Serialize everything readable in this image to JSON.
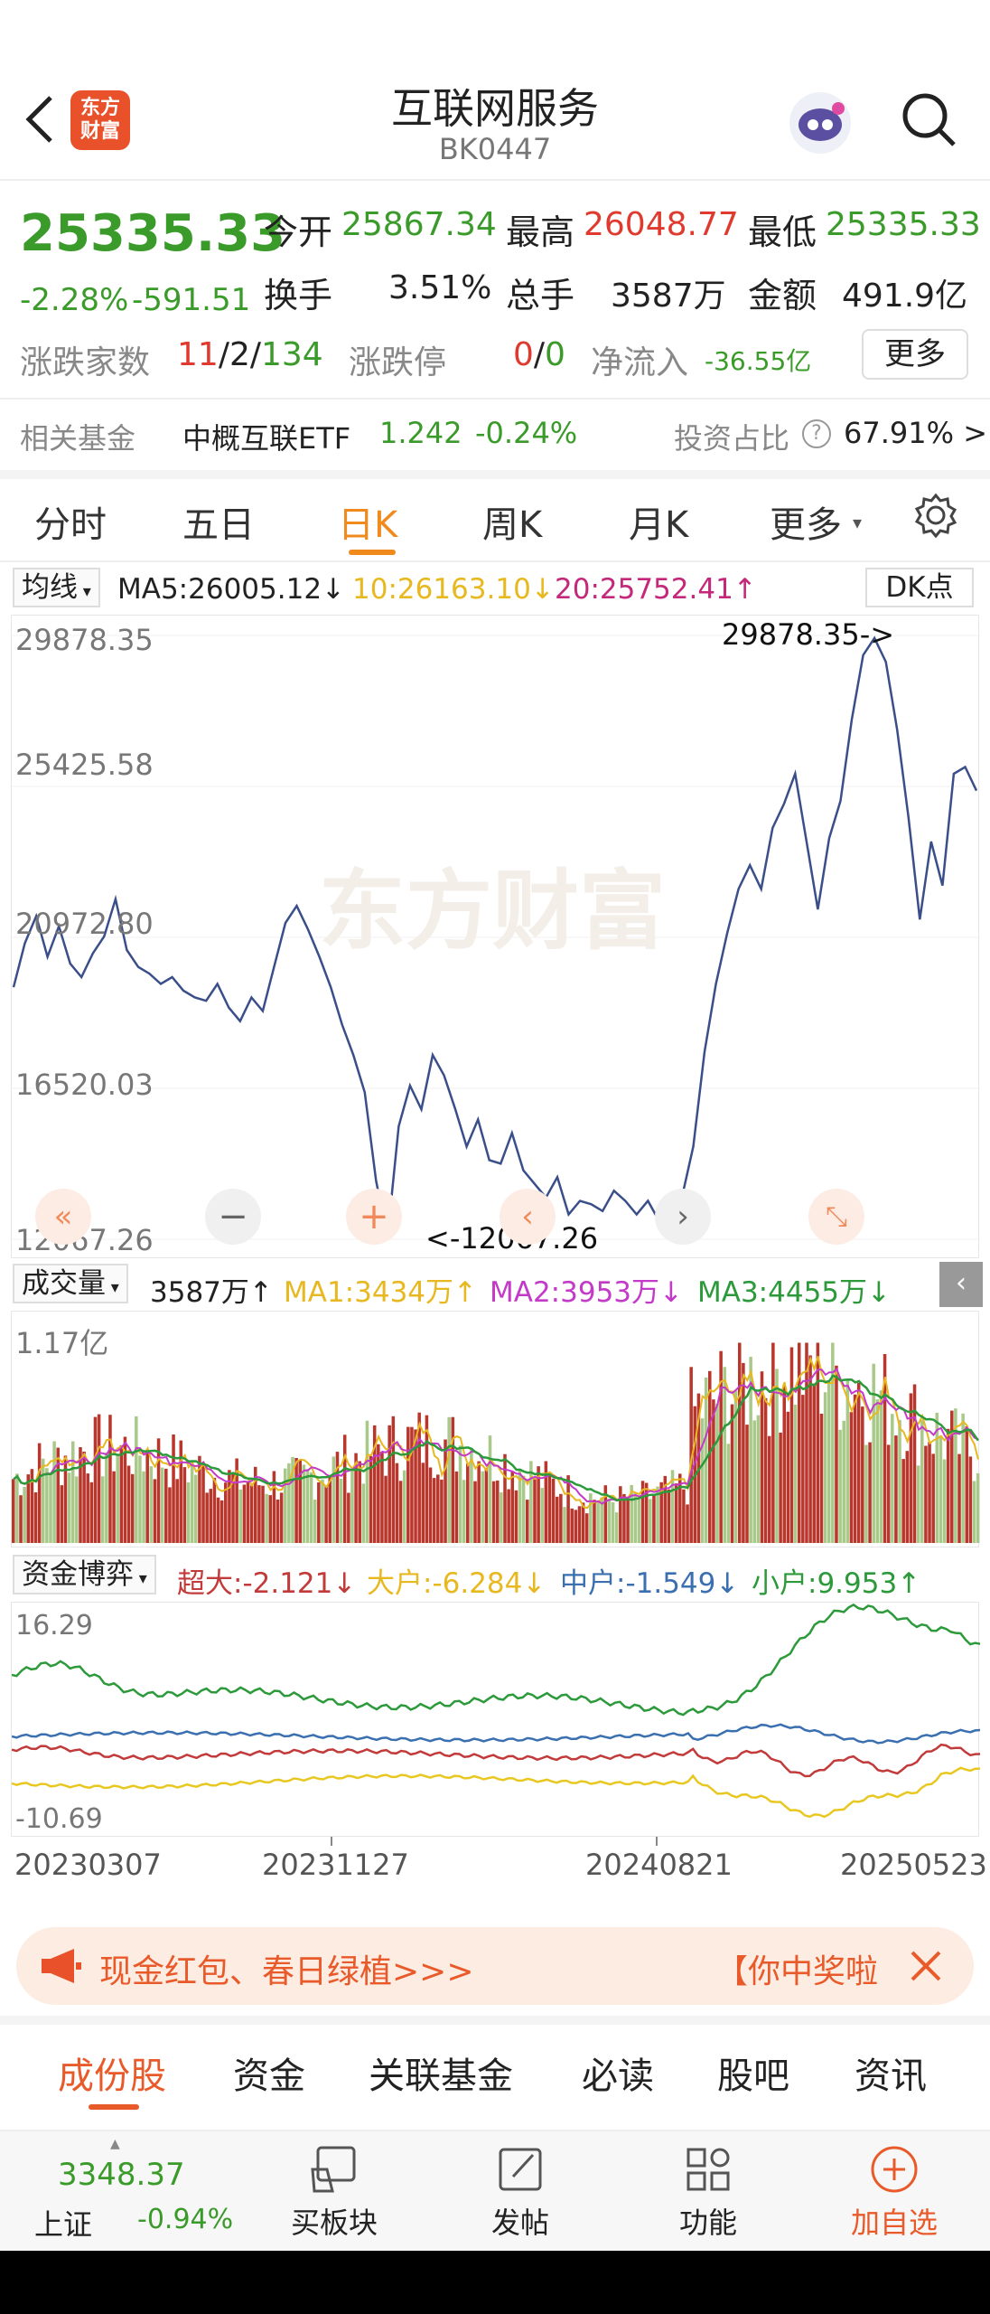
{
  "header": {
    "title": "互联网服务",
    "code": "BK0447",
    "logo_text_1": "东方",
    "logo_text_2": "财富"
  },
  "quote": {
    "price": "25335.33",
    "change_pct": "-2.28%",
    "change": "-591.51",
    "open_label": "今开",
    "open": "25867.34",
    "high_label": "最高",
    "high": "26048.77",
    "low_label": "最低",
    "low": "25335.33",
    "turnover_label": "换手",
    "turnover": "3.51%",
    "volume_label": "总手",
    "volume": "3587万",
    "amount_label": "金额",
    "amount": "491.9亿",
    "updown_label": "涨跌家数",
    "up_count": "11",
    "flat_count": "2",
    "down_count": "134",
    "limit_label": "涨跌停",
    "limit_up": "0",
    "limit_down": "0",
    "netflow_label": "净流入",
    "netflow": "-36.55亿",
    "more_button": "更多",
    "sep": "/"
  },
  "fund": {
    "label": "相关基金",
    "name": "中概互联ETF",
    "price": "1.242",
    "change": "-0.24%",
    "ratio_label": "投资占比",
    "ratio": "67.91% >"
  },
  "tabs": [
    {
      "label": "分时"
    },
    {
      "label": "五日"
    },
    {
      "label": "日K"
    },
    {
      "label": "周K"
    },
    {
      "label": "月K"
    },
    {
      "label": "更多"
    }
  ],
  "ma_bar": {
    "selector": "均线",
    "ma5": "MA5:26005.12↓",
    "ma10": "10:26163.10↓",
    "ma20": "20:25752.41↑",
    "dk": "DK点"
  },
  "volume_bar": {
    "selector": "成交量",
    "vol": "3587万↑",
    "ma1": "MA1:3434万↑",
    "ma2": "MA2:3953万↓",
    "ma3": "MA3:4455万↓"
  },
  "flow_bar": {
    "selector": "资金博弈",
    "super": "超大:-2.121↓",
    "large": "大户:-6.284↓",
    "mid": "中户:-1.549↓",
    "small": "小户:9.953↑"
  },
  "chart_data": {
    "type": "line",
    "price_labels": [
      "29878.35",
      "25425.58",
      "20972.80",
      "16520.03",
      "12067.26"
    ],
    "max_annotation": "29878.35->",
    "min_annotation": "<-12067.26",
    "ylim": [
      12067.26,
      29878.35
    ],
    "volume_top_label": "1.17亿",
    "flow_top_label": "16.29",
    "flow_bottom_label": "-10.69",
    "x_labels": [
      "20230307",
      "20231127",
      "20240821",
      "20250523"
    ],
    "series": [
      {
        "name": "MA5",
        "color": "#3a4f8a"
      }
    ],
    "price": [
      19500,
      20800,
      21600,
      20400,
      21300,
      20200,
      19800,
      20500,
      21000,
      22100,
      20600,
      20100,
      19900,
      19600,
      19800,
      19400,
      19200,
      19100,
      19600,
      18900,
      18500,
      19200,
      18800,
      20100,
      21400,
      21900,
      21200,
      20400,
      19500,
      18400,
      17500,
      16400,
      13800,
      12100,
      15400,
      16600,
      15900,
      17500,
      16900,
      15900,
      14800,
      15600,
      14400,
      14300,
      15200,
      14100,
      13700,
      13300,
      13900,
      12800,
      13200,
      13100,
      12900,
      13500,
      13200,
      12800,
      13200,
      12600,
      12900,
      13300,
      14800,
      17600,
      19600,
      21100,
      22400,
      23100,
      22400,
      24200,
      24900,
      25800,
      23800,
      21800,
      23900,
      25000,
      27400,
      29300,
      29800,
      29100,
      27100,
      24500,
      21500,
      23800,
      22500,
      25800,
      26000,
      25300
    ]
  },
  "promo": {
    "text": "现金红包、春日绿植>>>",
    "right_text": "【你中奖啦"
  },
  "sub_tabs": [
    {
      "label": "成份股"
    },
    {
      "label": "资金"
    },
    {
      "label": "关联基金"
    },
    {
      "label": "必读"
    },
    {
      "label": "股吧"
    },
    {
      "label": "资讯"
    }
  ],
  "bottom": {
    "index_value": "3348.37",
    "index_name": "上证",
    "index_change": "-0.94%",
    "buy_block": "买板块",
    "post": "发帖",
    "functions": "功能",
    "add_watch": "加自选"
  },
  "colors": {
    "up": "#e03a2f",
    "down": "#3a9a2a",
    "accent": "#f08a1c",
    "line": "#3a4f8a"
  }
}
